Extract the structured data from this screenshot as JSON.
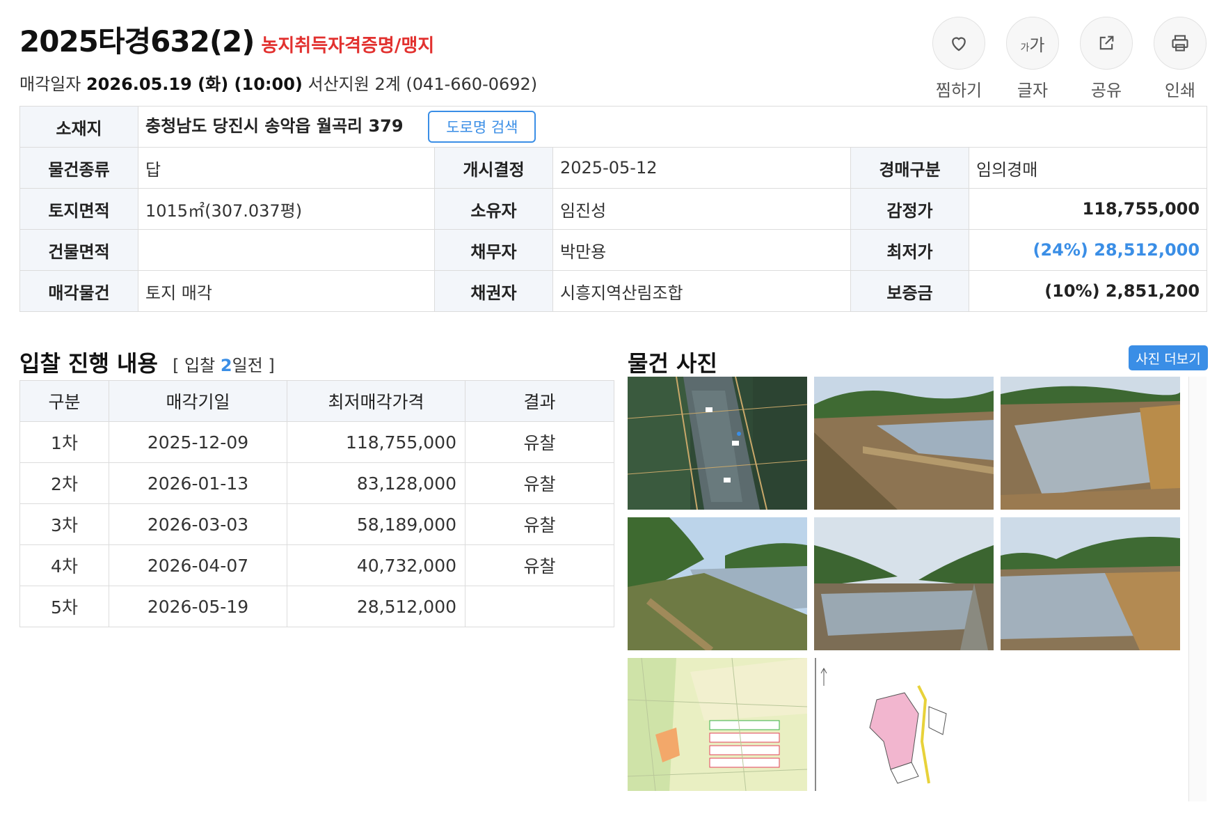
{
  "header": {
    "case_number": "2025타경632(2)",
    "tag": "농지취득자격증명/맹지",
    "sale_date_label": "매각일자",
    "sale_date": "2026.05.19 (화) (10:00)",
    "court": "서산지원 2계 (041-660-0692)"
  },
  "actions": [
    {
      "label": "찜하기",
      "icon": "heart-icon"
    },
    {
      "label": "글자",
      "icon": "font-size-icon"
    },
    {
      "label": "공유",
      "icon": "share-icon"
    },
    {
      "label": "인쇄",
      "icon": "print-icon"
    }
  ],
  "font_icon": {
    "small": "가",
    "large": "가"
  },
  "info": {
    "address_label": "소재지",
    "address": "충청남도 당진시 송악읍 월곡리 379",
    "road_search": "도로명 검색",
    "type_label": "물건종류",
    "type": "답",
    "start_label": "개시결정",
    "start": "2025-05-12",
    "auction_kind_label": "경매구분",
    "auction_kind": "임의경매",
    "land_label": "토지면적",
    "land": "1015㎡(307.037평)",
    "owner_label": "소유자",
    "owner": "임진성",
    "appraisal_label": "감정가",
    "appraisal": "118,755,000",
    "building_label": "건물면적",
    "building": "",
    "debtor_label": "채무자",
    "debtor": "박만용",
    "min_label": "최저가",
    "min": "(24%) 28,512,000",
    "item_label": "매각물건",
    "item": "토지 매각",
    "creditor_label": "채권자",
    "creditor": "시흥지역산림조합",
    "deposit_label": "보증금",
    "deposit": "(10%) 2,851,200"
  },
  "bids": {
    "title": "입찰 진행 내용",
    "sub_prefix": "[ 입찰",
    "sub_days": "2",
    "sub_suffix": "일전 ]",
    "headers": [
      "구분",
      "매각기일",
      "최저매각가격",
      "결과"
    ],
    "rows": [
      {
        "round": "1차",
        "date": "2025-12-09",
        "price": "118,755,000",
        "result": "유찰"
      },
      {
        "round": "2차",
        "date": "2026-01-13",
        "price": "83,128,000",
        "result": "유찰"
      },
      {
        "round": "3차",
        "date": "2026-03-03",
        "price": "58,189,000",
        "result": "유찰"
      },
      {
        "round": "4차",
        "date": "2026-04-07",
        "price": "40,732,000",
        "result": "유찰"
      },
      {
        "round": "5차",
        "date": "2026-05-19",
        "price": "28,512,000",
        "result": ""
      }
    ]
  },
  "photos": {
    "title": "물건 사진",
    "more": "사진 더보기",
    "items": [
      {
        "kind": "aerial-map"
      },
      {
        "kind": "paddy-field"
      },
      {
        "kind": "paddy-field"
      },
      {
        "kind": "paddy-field"
      },
      {
        "kind": "paddy-field"
      },
      {
        "kind": "paddy-field"
      },
      {
        "kind": "zoning-map"
      },
      {
        "kind": "cadastral-map"
      }
    ]
  },
  "colors": {
    "accent": "#3a8ee6",
    "tag_red": "#e2312f",
    "header_bg": "#f3f6fa"
  }
}
